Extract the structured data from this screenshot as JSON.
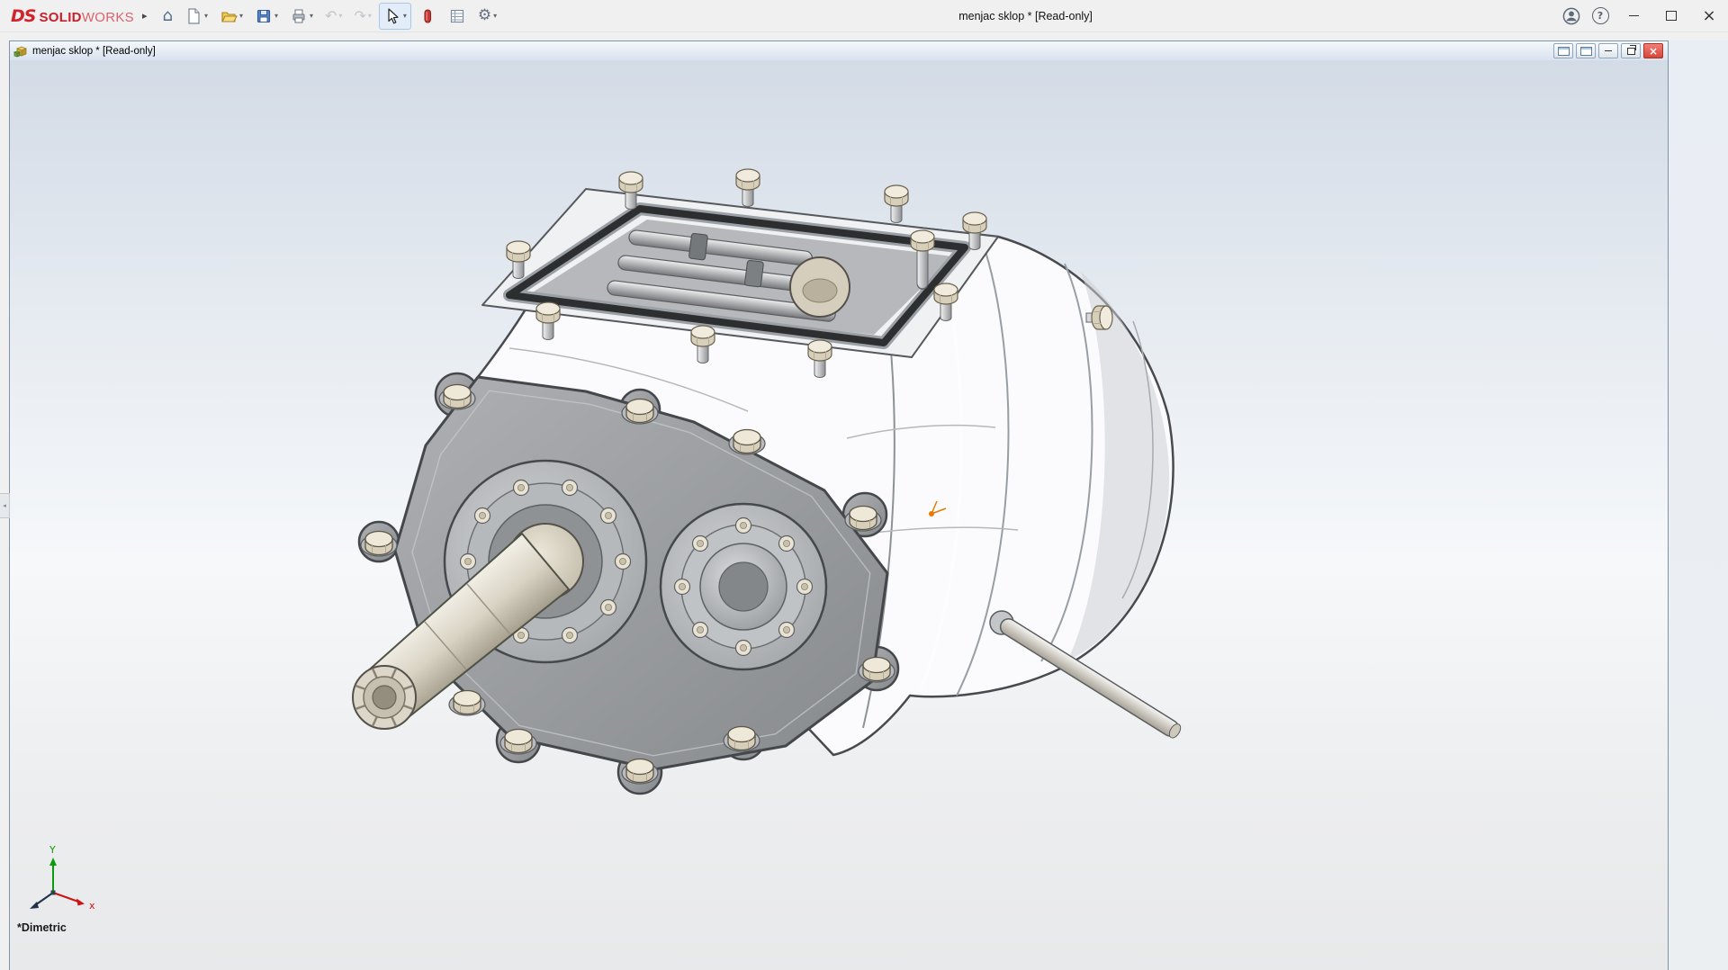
{
  "app": {
    "logo": {
      "ds": "DS",
      "solid": "SOLID",
      "works": "WORKS"
    },
    "title": "menjac sklop * [Read-only]",
    "glyphs": {
      "menu_chevron": "▸",
      "home": "⌂",
      "undo": "↶",
      "redo": "↷",
      "options_gear": "⚙",
      "dropdown": "▾",
      "help": "?",
      "close": "×",
      "collapse_arrow": "◂"
    },
    "toolbar_items": [
      "home",
      "new-document",
      "open",
      "save",
      "print",
      "undo",
      "redo",
      "select",
      "appearance",
      "document-properties",
      "options"
    ]
  },
  "doc_window": {
    "title": "menjac sklop * [Read-only]"
  },
  "viewport": {
    "view_orientation_label": "*Dimetric",
    "triad": {
      "x_label": "x",
      "y_label": "Y"
    }
  },
  "colors": {
    "brand_red": "#d2232a",
    "origin_marker": "#e87a00",
    "doc_close_button": "#d84438"
  }
}
